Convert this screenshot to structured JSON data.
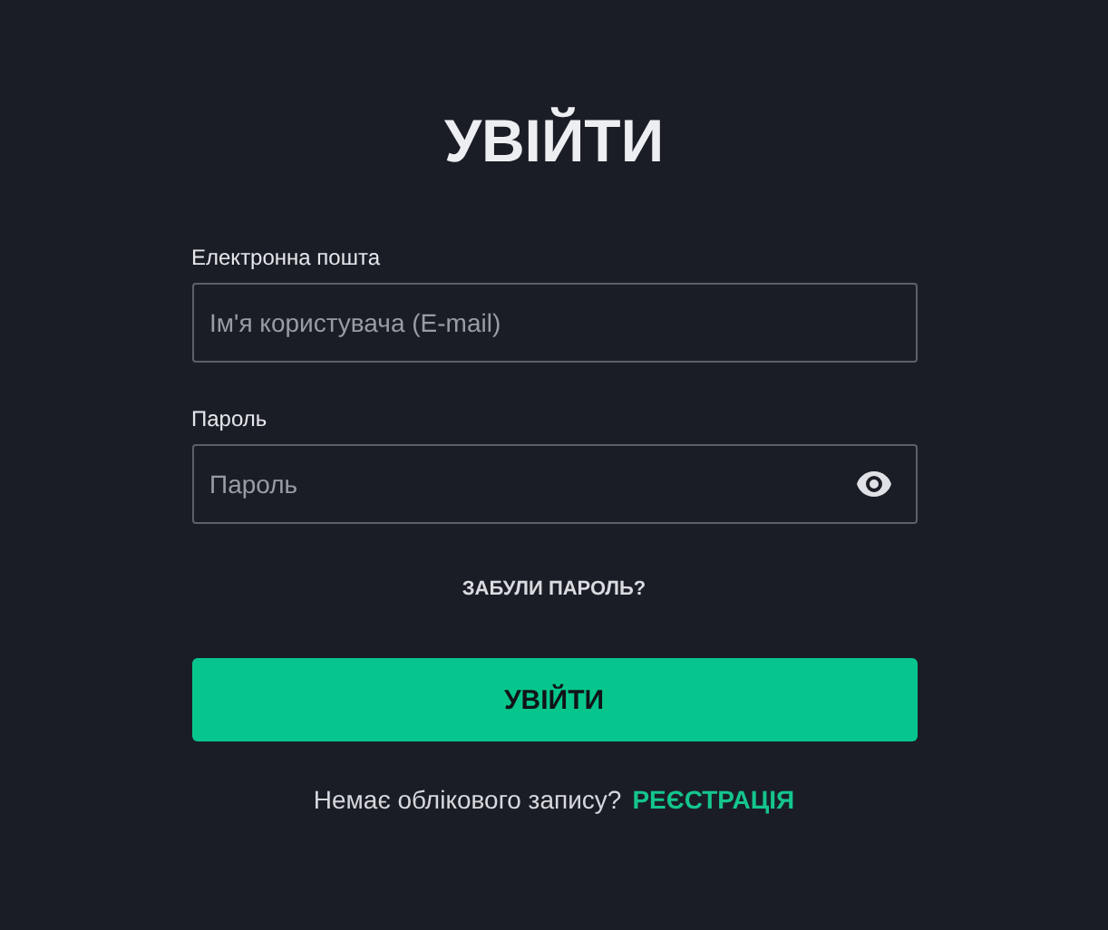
{
  "title": "УВІЙТИ",
  "fields": [
    {
      "label": "Електронна пошта",
      "placeholder": "Ім'я користувача (E-mail)",
      "kind": "text"
    },
    {
      "label": "Пароль",
      "placeholder": "Пароль",
      "kind": "password"
    }
  ],
  "forgot_link": "ЗАБУЛИ ПАРОЛЬ?",
  "submit_button": "УВІЙТИ",
  "signup": {
    "text": "Немає облікового запису?",
    "link": "РЕЄСТРАЦІЯ"
  }
}
